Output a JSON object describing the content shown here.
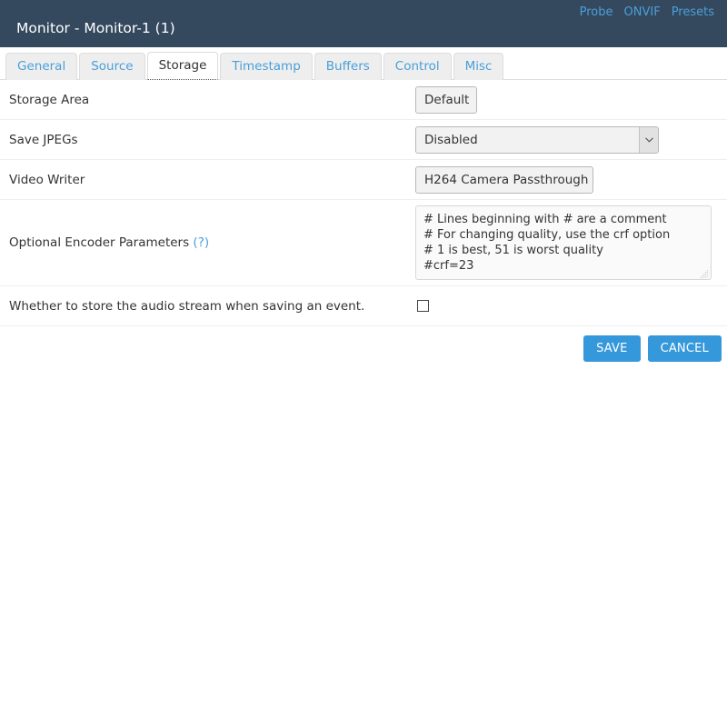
{
  "header": {
    "title": "Monitor - Monitor-1 (1)",
    "links": [
      {
        "label": "Probe",
        "name": "probe-link"
      },
      {
        "label": "ONVIF",
        "name": "onvif-link"
      },
      {
        "label": "Presets",
        "name": "presets-link"
      }
    ],
    "background_color": "#34495e",
    "link_color": "#4a9fd8"
  },
  "tabs": [
    {
      "label": "General",
      "active": false
    },
    {
      "label": "Source",
      "active": false
    },
    {
      "label": "Storage",
      "active": true
    },
    {
      "label": "Timestamp",
      "active": false
    },
    {
      "label": "Buffers",
      "active": false
    },
    {
      "label": "Control",
      "active": false
    },
    {
      "label": "Misc",
      "active": false
    }
  ],
  "form": {
    "storage_area": {
      "label": "Storage Area",
      "value": "Default"
    },
    "save_jpegs": {
      "label": "Save JPEGs",
      "value": "Disabled"
    },
    "video_writer": {
      "label": "Video Writer",
      "value": "H264 Camera Passthrough"
    },
    "encoder_params": {
      "label": "Optional Encoder Parameters",
      "help_label": "(?)",
      "value": "# Lines beginning with # are a comment\n# For changing quality, use the crf option\n# 1 is best, 51 is worst quality\n#crf=23"
    },
    "audio_stream": {
      "label": "Whether to store the audio stream when saving an event.",
      "checked": false
    }
  },
  "buttons": {
    "save_label": "SAVE",
    "cancel_label": "CANCEL",
    "accent_color": "#3498db"
  }
}
